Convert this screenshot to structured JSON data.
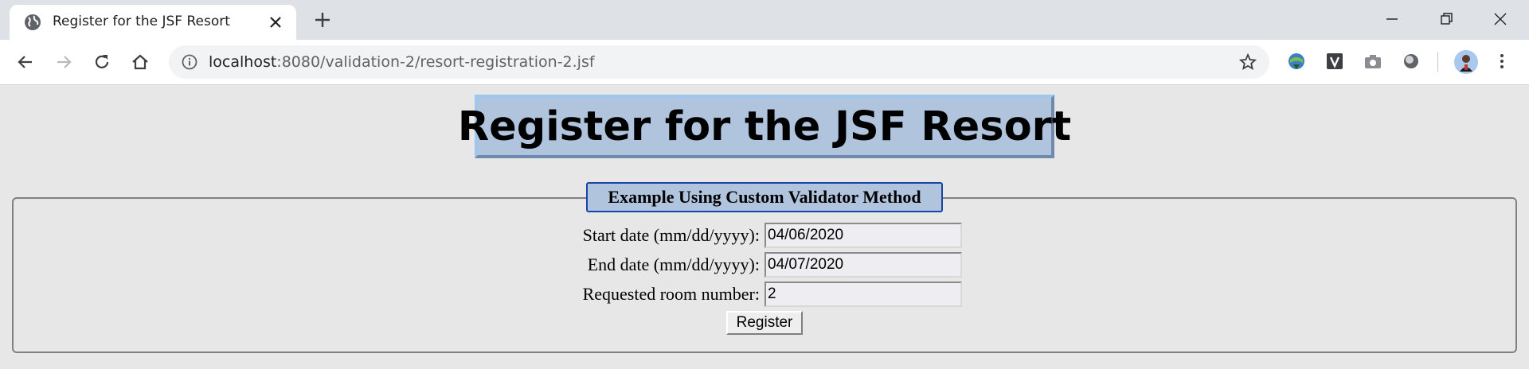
{
  "browser": {
    "tab_title": "Register for the JSF Resort",
    "url_host": "localhost",
    "url_path": ":8080/validation-2/resort-registration-2.jsf"
  },
  "page": {
    "heading": "Register for the JSF Resort",
    "legend": "Example Using Custom Validator Method",
    "fields": [
      {
        "label": "Start date (mm/dd/yyyy):",
        "value": "04/06/2020"
      },
      {
        "label": "End date (mm/dd/yyyy):",
        "value": "04/07/2020"
      },
      {
        "label": "Requested room number:",
        "value": "2"
      }
    ],
    "submit_label": "Register"
  },
  "icons": {
    "tab_favicon": "globe-icon",
    "tab_close": "close-icon",
    "new_tab": "plus-icon",
    "minimize": "minimize-icon",
    "restore": "restore-icon",
    "close_window": "close-icon",
    "back": "back-arrow-icon",
    "forward": "forward-arrow-icon",
    "reload": "reload-icon",
    "home": "home-icon",
    "site_info": "info-icon",
    "bookmark": "star-icon",
    "extensions": [
      "download-manager-icon",
      "v-extension-icon",
      "camera-icon",
      "circle-extension-icon"
    ],
    "profile": "avatar-icon",
    "menu": "kebab-menu-icon"
  },
  "colors": {
    "page_background": "#e7e7e7",
    "heading_background": "#b0c4de",
    "legend_border": "#1a45a8",
    "tabstrip": "#dee1e6"
  }
}
